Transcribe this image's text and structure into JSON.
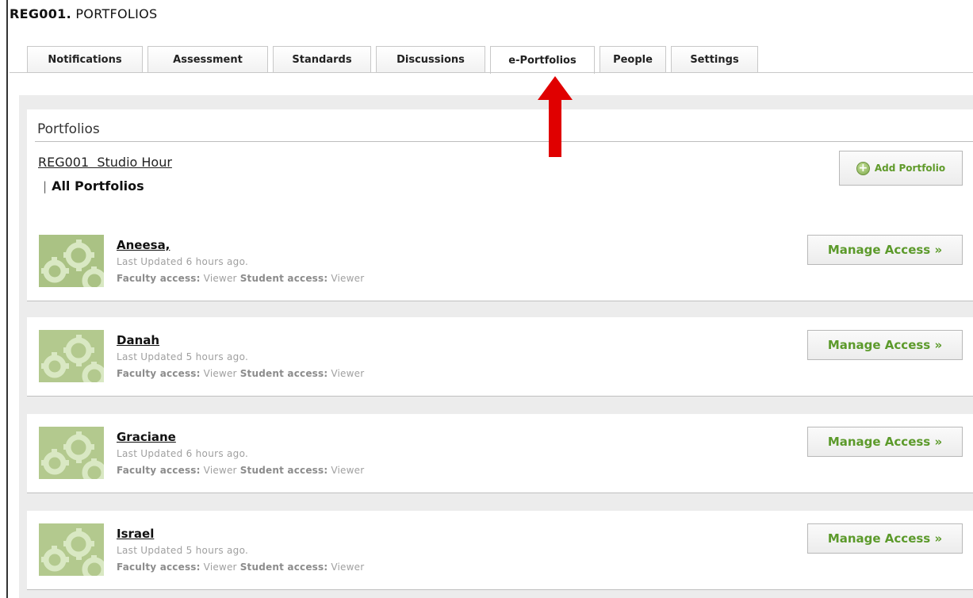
{
  "page": {
    "course_code": "REG001.",
    "course_title": "PORTFOLIOS"
  },
  "tabs": [
    {
      "label": "Notifications",
      "active": false
    },
    {
      "label": "Assessment",
      "active": false
    },
    {
      "label": "Standards",
      "active": false
    },
    {
      "label": "Discussions",
      "active": false
    },
    {
      "label": "e-Portfolios",
      "active": true
    },
    {
      "label": "People",
      "active": false
    },
    {
      "label": "Settings",
      "active": false
    }
  ],
  "header": {
    "section_title": "Portfolios",
    "breadcrumb_link": "REG001  Studio Hour",
    "breadcrumb_tick": "|",
    "breadcrumb_current": "All Portfolios",
    "add_button_label": "Add Portfolio",
    "add_icon": "plus-circle-icon"
  },
  "portfolios": [
    {
      "name": "Aneesa,",
      "updated": "Last Updated 6 hours ago.",
      "faculty_label": "Faculty access:",
      "faculty_value": "Viewer",
      "student_label": "Student access:",
      "student_value": "Viewer",
      "button_label": "Manage Access »"
    },
    {
      "name": "Danah ",
      "updated": "Last Updated 5 hours ago.",
      "faculty_label": "Faculty access:",
      "faculty_value": "Viewer",
      "student_label": "Student access:",
      "student_value": "Viewer",
      "button_label": "Manage Access »"
    },
    {
      "name": "Graciane ",
      "updated": "Last Updated 6 hours ago.",
      "faculty_label": "Faculty access:",
      "faculty_value": "Viewer",
      "student_label": "Student access:",
      "student_value": "Viewer",
      "button_label": "Manage Access »"
    },
    {
      "name": "Israel ",
      "updated": "Last Updated 5 hours ago.",
      "faculty_label": "Faculty access:",
      "faculty_value": "Viewer",
      "student_label": "Student access:",
      "student_value": "Viewer",
      "button_label": "Manage Access »"
    }
  ],
  "annotation": {
    "arrow_color": "#e00000",
    "arrow_points_to": "e-Portfolios"
  },
  "colors": {
    "accent_green": "#5c9a2b",
    "panel_bg": "#ececec"
  }
}
